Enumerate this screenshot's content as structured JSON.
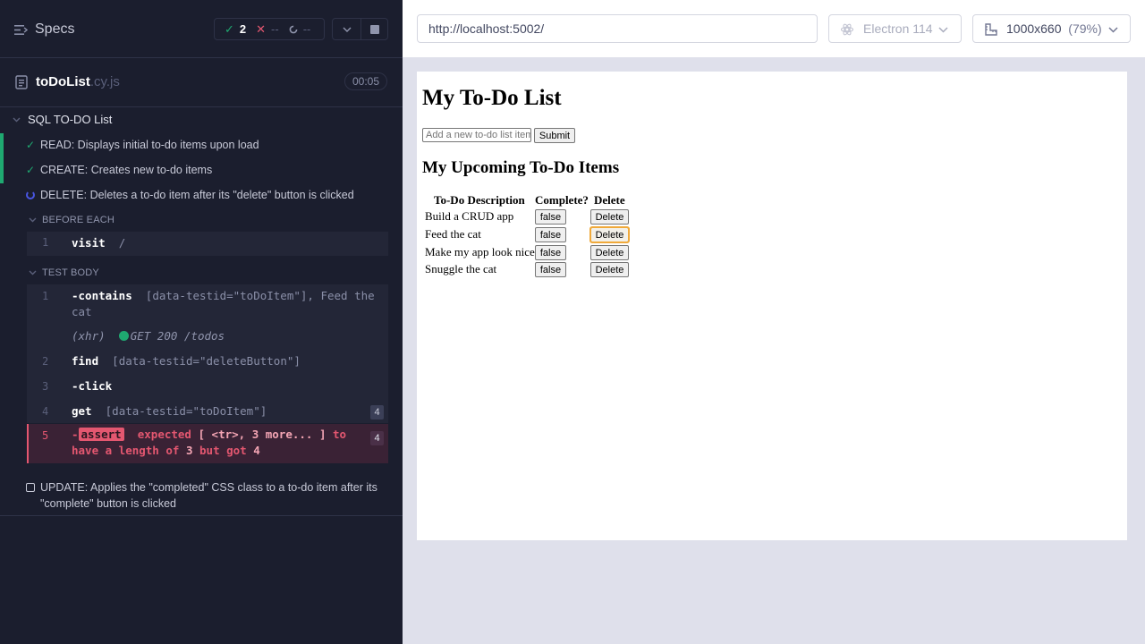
{
  "reporter": {
    "specs_label": "Specs",
    "stats": {
      "passed": "2",
      "failed": "--",
      "pending": "--"
    },
    "file": {
      "name": "toDoList",
      "ext": ".cy.js",
      "duration": "00:05"
    },
    "suite_title": "SQL TO-DO List",
    "tests": [
      {
        "label": "READ: Displays initial to-do items upon load",
        "state": "passed"
      },
      {
        "label": "CREATE: Creates new to-do items",
        "state": "passed"
      },
      {
        "label": "DELETE: Deletes a to-do item after its \"delete\" button is clicked",
        "state": "running"
      }
    ],
    "before_each_label": "BEFORE EACH",
    "test_body_label": "TEST BODY",
    "before_each_cmd": {
      "num": "1",
      "name": "visit",
      "msg": "/"
    },
    "cmd1": {
      "num": "1",
      "name": "-contains",
      "msg_a": "[data-testid=\"toDoItem\"], Feed the",
      "msg_b": "cat"
    },
    "xhr": {
      "tag": "(xhr)",
      "msg": "GET 200 /todos"
    },
    "cmd2": {
      "num": "2",
      "name": "find",
      "msg": "[data-testid=\"deleteButton\"]"
    },
    "cmd3": {
      "num": "3",
      "name": "-click"
    },
    "cmd4": {
      "num": "4",
      "name": "get",
      "msg": "[data-testid=\"toDoItem\"]",
      "badge": "4"
    },
    "cmd5": {
      "num": "5",
      "dash": "-",
      "name": "assert",
      "line1_a": "expected",
      "line1_b": "[ <tr>, 3 more... ]",
      "line1_c": "to",
      "line2_a": "have a length of",
      "line2_b": "3",
      "line2_c": "but got",
      "line2_d": "4",
      "badge": "4"
    },
    "update_test": "UPDATE: Applies the \"completed\" CSS class to a to-do item after its \"complete\" button is clicked"
  },
  "aut": {
    "url": "http://localhost:5002/",
    "browser": "Electron 114",
    "viewport": "1000x660",
    "viewport_pct": "(79%)",
    "app": {
      "title": "My To-Do List",
      "input_placeholder": "Add a new to-do list item",
      "submit_label": "Submit",
      "subtitle": "My Upcoming To-Do Items",
      "columns": [
        "To-Do Description",
        "Complete?",
        "Delete"
      ],
      "rows": [
        {
          "description": "Build a CRUD app",
          "complete": "false",
          "delete": "Delete"
        },
        {
          "description": "Feed the cat",
          "complete": "false",
          "delete": "Delete"
        },
        {
          "description": "Make my app look nice",
          "complete": "false",
          "delete": "Delete"
        },
        {
          "description": "Snuggle the cat",
          "complete": "false",
          "delete": "Delete"
        }
      ]
    }
  },
  "colors": {
    "pass": "#1fa971",
    "fail": "#e45770",
    "accent": "#4956e3",
    "focus": "#f0a93a"
  }
}
